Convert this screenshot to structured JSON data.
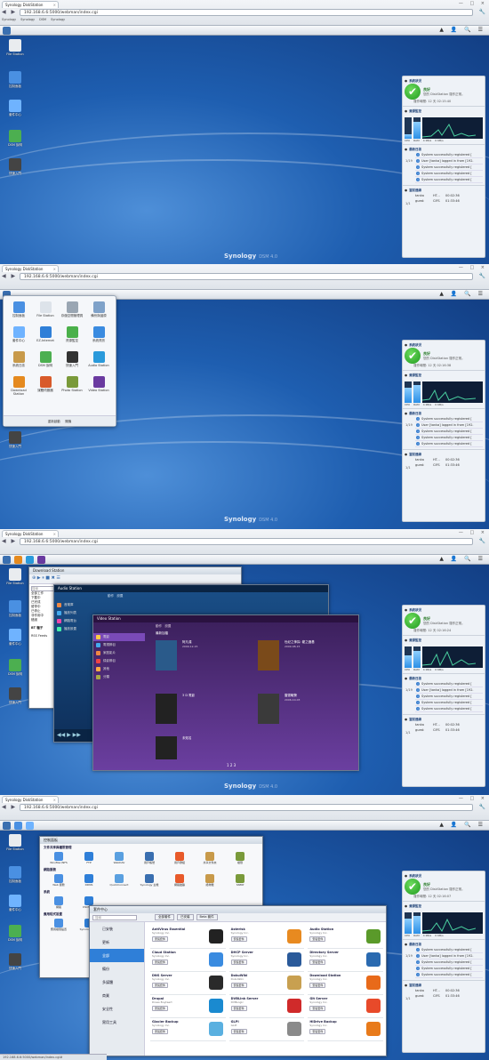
{
  "browser": {
    "tab_title": "Synology DiskStation",
    "window_controls": "— □ ×",
    "nav_icons": "◀ ▶ ⟳",
    "address": "192.168.6.6:5000/webman/index.cgi",
    "bookmarks": [
      "Synology",
      "Synology",
      "DSM",
      "Synology",
      "Synology",
      "Synology",
      "Synology",
      "Synology"
    ],
    "status_url": "192.168.6.6:5000/webman/index.cgi#"
  },
  "desktop": {
    "icons": [
      {
        "label": "File Station",
        "color": "#e9ecef"
      },
      {
        "label": "控制面板",
        "color": "#4a90e2"
      },
      {
        "label": "套件中心",
        "color": "#6fb3ff"
      },
      {
        "label": "DSM 說明",
        "color": "#4caf50"
      },
      {
        "label": "快速入門",
        "color": "#444444"
      }
    ],
    "logo": "Synology",
    "logo_sub": "DSM 4.0",
    "taskbar_right": "▲ 👤 🔍 ☰"
  },
  "widget": {
    "health_title": "系統狀況",
    "health_status": "良好",
    "health_desc": "您的 DiskStation 運作正常。",
    "uptime_label": "運作時間:",
    "uptimes": [
      "12 天 02:15:40",
      "12 天 02:16:38",
      "12 天 02:16:24",
      "12 天 02:16:07"
    ],
    "resource_title": "資源監控",
    "cpu_label": "CPU",
    "ram_label": "RAM",
    "net_up": "4 KB/s",
    "net_down": "0 KB/s",
    "cpu_levels": [
      0.2,
      0.7,
      0.6,
      0.7
    ],
    "ram_levels": [
      0.8,
      0.85,
      0.8,
      0.85
    ],
    "log_title": "最新日誌",
    "logs": [
      "System successfully registered [",
      "User [tanka] logged in from [192.",
      "System successfully registered [",
      "System successfully registered [",
      "System successfully registered ["
    ],
    "page": "1/19",
    "users_title": "當前連線",
    "users": [
      {
        "name": "tanka",
        "type": "HT...",
        "time": "00:02:36"
      },
      {
        "name": "guest",
        "type": "CIFS",
        "time": "01:33:46"
      }
    ],
    "users_page": "1/1"
  },
  "main_menu": {
    "items": [
      {
        "label": "控制面板",
        "color": "#4a90e2"
      },
      {
        "label": "File Station",
        "color": "#dde3ea"
      },
      {
        "label": "存儲空間管理員",
        "color": "#9aa6b3"
      },
      {
        "label": "備份與還原",
        "color": "#7fa2c9"
      },
      {
        "label": "套件中心",
        "color": "#6fb3ff"
      },
      {
        "label": "EZ-Internet",
        "color": "#2f7fd8"
      },
      {
        "label": "資源監控",
        "color": "#4ab04a"
      },
      {
        "label": "系統資訊",
        "color": "#3a8be0"
      },
      {
        "label": "系統日誌",
        "color": "#c89a4a"
      },
      {
        "label": "DSM 說明",
        "color": "#4caf50"
      },
      {
        "label": "快速入門",
        "color": "#333333"
      },
      {
        "label": "Audio Station",
        "color": "#2a9adb"
      },
      {
        "label": "Download Station",
        "color": "#e58a1f"
      },
      {
        "label": "媒體伺服器",
        "color": "#d85a2a"
      },
      {
        "label": "Photo Station",
        "color": "#7a9a3a"
      },
      {
        "label": "Video Station",
        "color": "#6a3aa0"
      }
    ],
    "restart": "重新啟動",
    "shutdown": "關機"
  },
  "download_station": {
    "title": "Download Station",
    "search_placeholder": "搜尋",
    "tree": [
      "全部工作",
      "下載中",
      "已完成",
      "暫停中",
      "已停止",
      "非作用中",
      "錯誤"
    ],
    "bt": "BT 種子",
    "rss": "RSS Feeds"
  },
  "audio_station": {
    "title": "Audio Station",
    "nav": [
      "音樂庫",
      "播放列表",
      "網路電台",
      "播放設置"
    ],
    "toolbar": [
      "動作",
      "設置"
    ]
  },
  "video_station": {
    "title": "Video Station",
    "toolbar": [
      "動作",
      "設置"
    ],
    "breadcrumb": "最新加檔",
    "nav": [
      "電影",
      "電視節目",
      "家庭影片",
      "錄影節目",
      "其他",
      "分類"
    ],
    "movies": [
      {
        "title": "阿凡達",
        "year": "2009-12-15",
        "color": "#2a5a8a"
      },
      {
        "title": "世紀之神探: 龍之器基",
        "year": "2009-08-15",
        "color": "#7a4a1a"
      },
      {
        "title": "3 D 電影",
        "year": "",
        "color": "#222222"
      },
      {
        "title": "雷霆戰警",
        "year": "2006-10-03",
        "color": "#3a3a3a"
      },
      {
        "title": "未知名",
        "year": "",
        "color": "#222222"
      }
    ],
    "pager": "1 2 3"
  },
  "control_panel": {
    "title": "控制面板",
    "sections": [
      "文件共享與權限管理",
      "網路服務",
      "系統",
      "應用程式設置"
    ],
    "row1": [
      "Win/Mac/NFS",
      "FTP",
      "WebDAV",
      "用戶帳號",
      "用戶群組",
      "共享文件夾",
      "權限"
    ],
    "row2": [
      "Web 服務",
      "DDNS",
      "QuickConnect",
      "Synology 主機",
      "網路磁碟",
      "終端機",
      "SNMP"
    ],
    "row3": [
      "網路",
      "DSM 設置"
    ],
    "row4": [
      "應用權限設置",
      "Synology 應用"
    ]
  },
  "package_center": {
    "title": "套件中心",
    "search_placeholder": "搜尋",
    "tabs": [
      "全部套件",
      "已安裝",
      "Beta 套件"
    ],
    "nav": [
      "已安裝",
      "更新",
      "全部",
      "備份",
      "多媒體",
      "商業",
      "安全性",
      "實用工具"
    ],
    "install": "安裝套件",
    "packages": [
      {
        "name": "AntiVirus Essential",
        "vendor": "Synology Inc.",
        "color": "#222222"
      },
      {
        "name": "Asterisk",
        "vendor": "Synology Inc.",
        "color": "#e88a20"
      },
      {
        "name": "Audio Station",
        "vendor": "Synology Inc.",
        "color": "#5a9a2a"
      },
      {
        "name": "Cloud Station",
        "vendor": "Synology Inc.",
        "color": "#3a8be0"
      },
      {
        "name": "DHCP Server",
        "vendor": "Synology Inc.",
        "color": "#2a5a9a"
      },
      {
        "name": "Directory Server",
        "vendor": "Synology Inc.",
        "color": "#2a6ab0"
      },
      {
        "name": "DNS Server",
        "vendor": "Synology Inc.",
        "color": "#2a2a2a"
      },
      {
        "name": "DokuWiki",
        "vendor": "DokuWiki",
        "color": "#c8a050"
      },
      {
        "name": "Download Station",
        "vendor": "Synology Inc.",
        "color": "#e86a1a"
      },
      {
        "name": "Drupal",
        "vendor": "Drees Buytaert",
        "color": "#1a8ad0"
      },
      {
        "name": "DVBLink Server",
        "vendor": "DVBLogic",
        "color": "#d02a2a"
      },
      {
        "name": "Git Server",
        "vendor": "Synology Inc.",
        "color": "#e84a2a"
      },
      {
        "name": "Glacier Backup",
        "vendor": "Synology Inc.",
        "color": "#5ab0e0"
      },
      {
        "name": "GLPI",
        "vendor": "GLPI",
        "color": "#8a8a8a"
      },
      {
        "name": "HiDrive Backup",
        "vendor": "Synology Inc.",
        "color": "#e87a1a"
      }
    ]
  }
}
